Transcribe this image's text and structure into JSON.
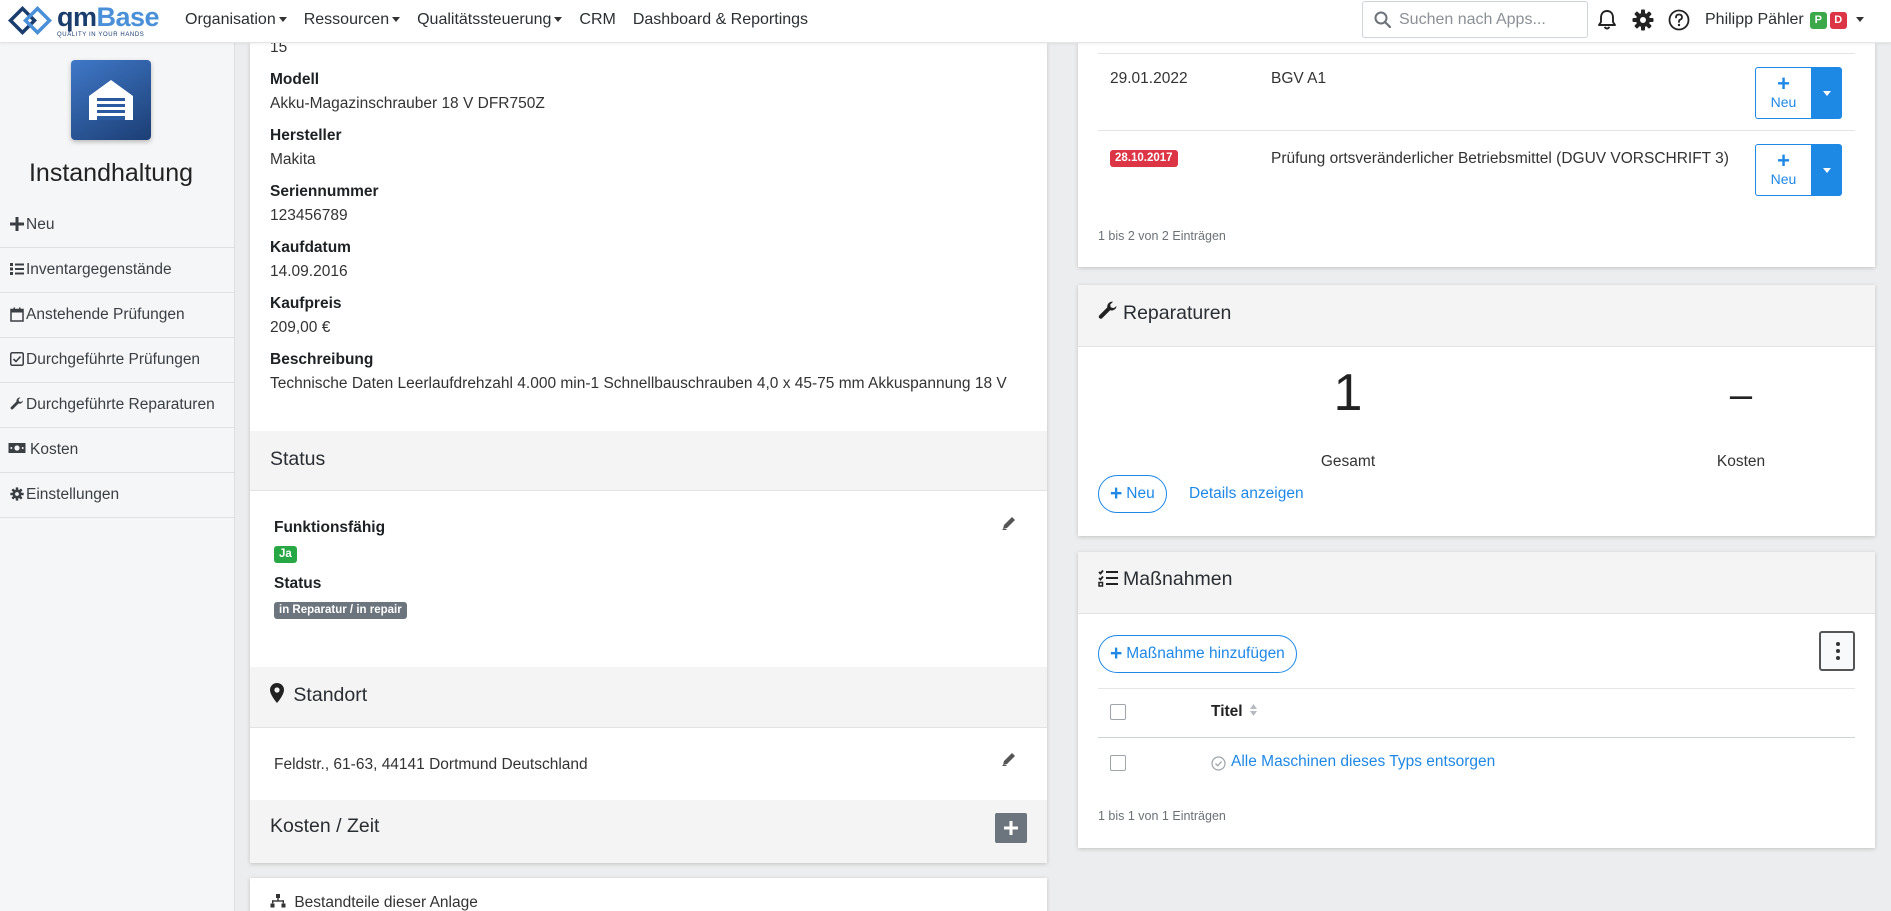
{
  "topbar": {
    "logo_name_q": "qm",
    "logo_name_b": "Base",
    "logo_tagline": "QUALITY IN YOUR HANDS",
    "nav": [
      {
        "label": "Organisation",
        "dropdown": true
      },
      {
        "label": "Ressourcen",
        "dropdown": true
      },
      {
        "label": "Qualitätssteuerung",
        "dropdown": true
      },
      {
        "label": "CRM",
        "dropdown": false
      },
      {
        "label": "Dashboard & Reportings",
        "dropdown": false
      }
    ],
    "search_placeholder": "Suchen nach Apps...",
    "icons": [
      "bell-icon",
      "gear-icon",
      "help-icon"
    ],
    "user_name": "Philipp Pähler",
    "badge_p": "P",
    "badge_d": "D"
  },
  "sidebar": {
    "app_title": "Instandhaltung",
    "items": [
      {
        "label": "Neu",
        "icon": "plus-icon"
      },
      {
        "label": "Inventargegenstände",
        "icon": "list-icon"
      },
      {
        "label": "Anstehende Prüfungen",
        "icon": "calendar-icon"
      },
      {
        "label": "Durchgeführte Prüfungen",
        "icon": "checkbox-icon"
      },
      {
        "label": "Durchgeführte Reparaturen",
        "icon": "wrench-icon"
      },
      {
        "label": "Kosten",
        "icon": "money-icon"
      },
      {
        "label": "Einstellungen",
        "icon": "cog-icon"
      }
    ]
  },
  "details": {
    "top_value": "15",
    "modell_label": "Modell",
    "modell": "Akku-Magazinschrauber 18 V DFR750Z",
    "hersteller_label": "Hersteller",
    "hersteller": "Makita",
    "seriennummer_label": "Seriennummer",
    "seriennummer": "123456789",
    "kaufdatum_label": "Kaufdatum",
    "kaufdatum": "14.09.2016",
    "kaufpreis_label": "Kaufpreis",
    "kaufpreis": "209,00 €",
    "beschreibung_label": "Beschreibung",
    "beschreibung": "Technische Daten Leerlaufdrehzahl 4.000 min-1 Schnellbauschrauben 4,0 x 45-75 mm Akkuspannung 18 V"
  },
  "status_section": {
    "title": "Status",
    "funktionsfaehig_label": "Funktionsfähig",
    "funktionsfaehig": "Ja",
    "status_label": "Status",
    "status": "in Reparatur / in repair"
  },
  "standort": {
    "title": "Standort",
    "address": "Feldstr., 61-63, 44141 Dortmund Deutschland"
  },
  "kosten_zeit": {
    "title": "Kosten / Zeit"
  },
  "bestandteile": {
    "title": "Bestandteile dieser Anlage"
  },
  "pruefungen": {
    "rows": [
      {
        "date": "29.01.2022",
        "overdue": false,
        "title": "BGV A1",
        "button": "Neu"
      },
      {
        "date": "28.10.2017",
        "overdue": true,
        "title": "Prüfung ortsveränderlicher Betriebsmittel (DGUV VORSCHRIFT 3)",
        "button": "Neu"
      }
    ],
    "info": "1 bis 2 von 2 Einträgen"
  },
  "reparaturen": {
    "title": "Reparaturen",
    "gesamt_value": "1",
    "gesamt_label": "Gesamt",
    "kosten_value": "–",
    "kosten_label": "Kosten",
    "new_button": "Neu",
    "details_link": "Details anzeigen"
  },
  "massnahmen": {
    "title": "Maßnahmen",
    "add_button": "Maßnahme hinzufügen",
    "column_title": "Titel",
    "rows": [
      {
        "title": "Alle Maschinen dieses Typs entsorgen"
      }
    ],
    "info": "1 bis 1 von 1 Einträgen"
  },
  "colors": {
    "primary": "#1e88e5",
    "success": "#28a745",
    "danger": "#dc3545",
    "secondary": "#6c757d"
  }
}
